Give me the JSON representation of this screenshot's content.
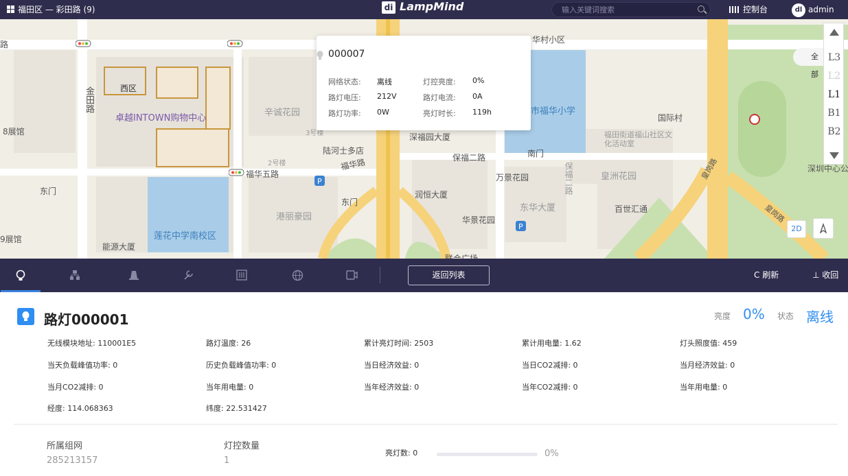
{
  "topbar": {
    "breadcrumb": "福田区 — 彩田路 (9)",
    "logo_text": "LampMind",
    "search_placeholder": "输入关键词搜索",
    "console_label": "控制台",
    "user_label": "admin"
  },
  "map": {
    "labels": {
      "xihu": "西区",
      "zhuoyue": "卓越INTOWN购物中心",
      "jintian": "金田路",
      "exhibit8": "8展馆",
      "exhibit9": "9展馆",
      "dongmen1": "东门",
      "dongmen2": "东门",
      "xincheng": "辛诚花园",
      "no3": "3号楼",
      "no2": "2号楼",
      "lohas": "陆河士多店",
      "fuhua5": "福华五路",
      "fuhua": "福华路",
      "gangli": "港丽豪园",
      "lianhua": "莲花中学南校区",
      "nengyuan": "能源大厦",
      "shenfu": "深福园大厦",
      "baofu2": "保福二路",
      "runheng": "润恒大厦",
      "nanmen": "南门",
      "wanjing": "万景花园",
      "baofu": "保福二路",
      "huangzhou": "皇洲花园",
      "dongya": "东华大厦",
      "huajing": "华景花园",
      "baihui": "百世汇通",
      "fuhua_school": "市福华小学",
      "guoji": "国际村",
      "fushan": "福田街道福山社区文化活动室",
      "fuhuacun": "华村小区",
      "center_park": "深圳中心公",
      "road_lu": "路",
      "lianhe": "联合广场",
      "huanggang": "皇岗路",
      "huangang2": "皇岗路"
    },
    "popup": {
      "id": "000007",
      "rows": [
        {
          "k1": "网络状态:",
          "v1": "离线",
          "k2": "灯控亮度:",
          "v2": "0%"
        },
        {
          "k1": "路灯电压:",
          "v1": "212V",
          "k2": "路灯电流:",
          "v2": "0A"
        },
        {
          "k1": "路灯功率:",
          "v1": "0W",
          "k2": "亮灯时长:",
          "v2": "119h"
        }
      ]
    },
    "floors": [
      "L3",
      "L2",
      "L1",
      "B1",
      "B2"
    ],
    "active_floor": "L1",
    "all_label": "全部",
    "view_2d": "2D"
  },
  "toolbar": {
    "tools": [
      "lamp-icon",
      "network-icon",
      "pole-icon",
      "wrench-icon",
      "meter-icon",
      "globe-icon",
      "camera-icon"
    ],
    "back_label": "返回列表",
    "refresh_label": "刷新",
    "collapse_label": "收回"
  },
  "detail": {
    "title": "路灯000001",
    "brightness_label": "亮度",
    "brightness_value": "0%",
    "status_label": "状态",
    "status_value": "离线",
    "fields": [
      [
        "无线模块地址: 110001E5",
        "路灯温度: 26",
        "累计亮灯时间: 2503",
        "累计用电量: 1.62",
        "灯头照度值: 459"
      ],
      [
        "当天负载峰值功率: 0",
        "历史负载峰值功率: 0",
        "当日经济效益: 0",
        "当日CO2减排: 0",
        "当月经济效益: 0"
      ],
      [
        "当月CO2减排: 0",
        "当年用电量: 0",
        "当年经济效益: 0",
        "当年CO2减排: 0",
        "当年用电量: 0"
      ],
      [
        "经度: 114.068363",
        "纬度: 22.531427"
      ]
    ],
    "summary": {
      "group_label": "所属组网",
      "group_value": "285213157",
      "count_label": "灯控数量",
      "count_value": "1",
      "lit_label": "亮灯数: 0",
      "lit_percent": "0%",
      "lit_fraction": 0
    }
  },
  "colors": {
    "topbar": "#2e2d4d",
    "accent": "#2f8ef2",
    "status_offline": "#2f8ef2"
  }
}
